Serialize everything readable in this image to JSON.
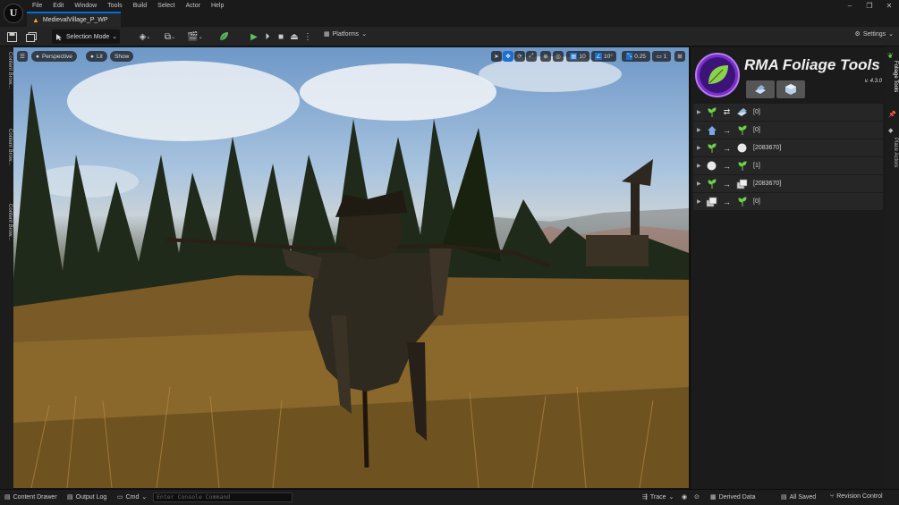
{
  "menu": [
    "File",
    "Edit",
    "Window",
    "Tools",
    "Build",
    "Select",
    "Actor",
    "Help"
  ],
  "document_tab": "MedievalVillage_P_WP",
  "toolbar": {
    "mode_label": "Selection Mode",
    "platforms_label": "Platforms",
    "settings_label": "Settings"
  },
  "left_tabs": [
    "Content Brow...",
    "Content Brow...",
    "Content Brow..."
  ],
  "right_tabs": [
    "Foliage Tools",
    "Place Actors"
  ],
  "viewport": {
    "view_mode": "Perspective",
    "lighting_mode": "Lit",
    "show_label": "Show",
    "grid_snap": "10",
    "rotation_snap": "10°",
    "scale_snap": "0.25",
    "camera_speed": "1"
  },
  "panel": {
    "title": "RMA Foliage Tools",
    "version": "v. 4.3.0",
    "rows": [
      {
        "left": "foliage",
        "connector": "⇄",
        "right": "static-mesh",
        "value": "[0]"
      },
      {
        "left": "house",
        "connector": "→",
        "right": "foliage",
        "value": "[0]"
      },
      {
        "left": "foliage",
        "connector": "→",
        "right": "sphere",
        "value": "[2083670]"
      },
      {
        "left": "sphere",
        "connector": "→",
        "right": "foliage",
        "value": "[1]"
      },
      {
        "left": "foliage",
        "connector": "→",
        "right": "mesh-stack",
        "value": "[2083670]"
      },
      {
        "left": "mesh-stack",
        "connector": "→",
        "right": "foliage",
        "value": "[0]"
      }
    ]
  },
  "statusbar": {
    "content_drawer": "Content Drawer",
    "output_log": "Output Log",
    "cmd": "Cmd",
    "console_placeholder": "Enter Console Command",
    "trace": "Trace",
    "derived_data": "Derived Data",
    "all_saved": "All Saved",
    "revision_control": "Revision Control"
  }
}
